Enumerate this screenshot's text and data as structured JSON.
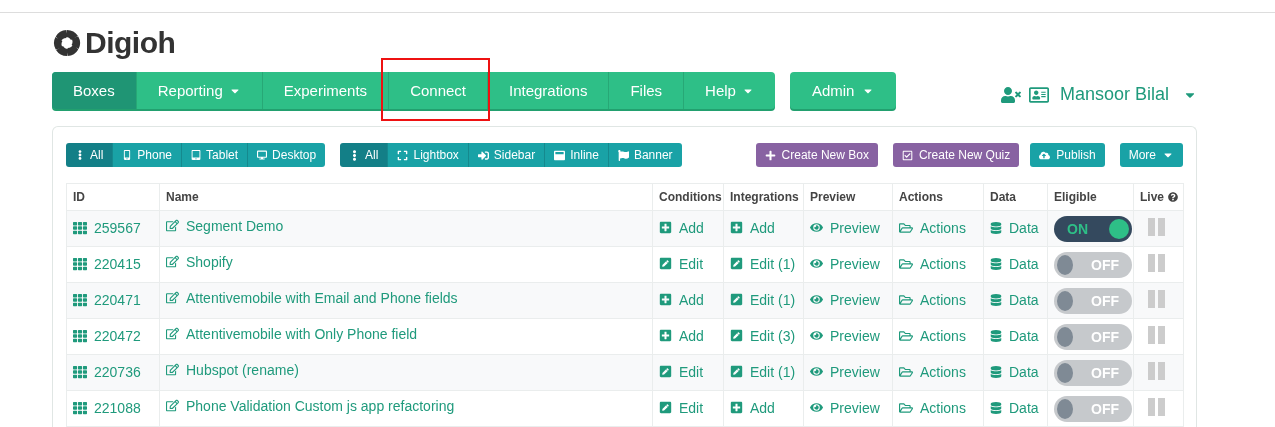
{
  "brand": {
    "name": "Digioh"
  },
  "nav": [
    {
      "label": "Boxes",
      "selected": true,
      "dropdown": false,
      "highlighted": false
    },
    {
      "label": "Reporting",
      "selected": false,
      "dropdown": true,
      "highlighted": false
    },
    {
      "label": "Experiments",
      "selected": false,
      "dropdown": false,
      "highlighted": false
    },
    {
      "label": "Connect",
      "selected": false,
      "dropdown": false,
      "highlighted": true
    },
    {
      "label": "Integrations",
      "selected": false,
      "dropdown": false,
      "highlighted": false
    },
    {
      "label": "Files",
      "selected": false,
      "dropdown": false,
      "highlighted": false
    },
    {
      "label": "Help",
      "selected": false,
      "dropdown": true,
      "highlighted": false
    }
  ],
  "admin_menu": {
    "label": "Admin"
  },
  "user": {
    "name": "Mansoor Bilal"
  },
  "device_filters": [
    {
      "label": "All",
      "selected": true
    },
    {
      "label": "Phone",
      "selected": false
    },
    {
      "label": "Tablet",
      "selected": false
    },
    {
      "label": "Desktop",
      "selected": false
    }
  ],
  "type_filters": [
    {
      "label": "All",
      "selected": true
    },
    {
      "label": "Lightbox",
      "selected": false
    },
    {
      "label": "Sidebar",
      "selected": false
    },
    {
      "label": "Inline",
      "selected": false
    },
    {
      "label": "Banner",
      "selected": false
    }
  ],
  "actions": [
    {
      "label": "Create New Box",
      "kind": "create"
    },
    {
      "label": "Create New Quiz",
      "kind": "quiz"
    },
    {
      "label": "Publish",
      "kind": "publish"
    },
    {
      "label": "More",
      "kind": "more"
    }
  ],
  "table": {
    "columns": [
      "ID",
      "Name",
      "Conditions",
      "Integrations",
      "Preview",
      "Actions",
      "Data",
      "Eligible",
      "Live"
    ],
    "rows": [
      {
        "id": "259567",
        "name": "Segment Demo",
        "conditions": {
          "label": "Add",
          "kind": "add"
        },
        "integrations": {
          "label": "Add",
          "kind": "add"
        },
        "preview": "Preview",
        "actions": "Actions",
        "data": "Data",
        "eligible": {
          "label": "ON",
          "on": true
        }
      },
      {
        "id": "220415",
        "name": "Shopify",
        "conditions": {
          "label": "Edit",
          "kind": "edit"
        },
        "integrations": {
          "label": "Edit (1)",
          "kind": "edit"
        },
        "preview": "Preview",
        "actions": "Actions",
        "data": "Data",
        "eligible": {
          "label": "OFF",
          "on": false
        }
      },
      {
        "id": "220471",
        "name": "Attentivemobile with Email and Phone fields",
        "conditions": {
          "label": "Add",
          "kind": "add"
        },
        "integrations": {
          "label": "Edit (1)",
          "kind": "edit"
        },
        "preview": "Preview",
        "actions": "Actions",
        "data": "Data",
        "eligible": {
          "label": "OFF",
          "on": false
        }
      },
      {
        "id": "220472",
        "name": "Attentivemobile with Only Phone field",
        "conditions": {
          "label": "Add",
          "kind": "add"
        },
        "integrations": {
          "label": "Edit (3)",
          "kind": "edit"
        },
        "preview": "Preview",
        "actions": "Actions",
        "data": "Data",
        "eligible": {
          "label": "OFF",
          "on": false
        }
      },
      {
        "id": "220736",
        "name": "Hubspot (rename)",
        "conditions": {
          "label": "Edit",
          "kind": "edit"
        },
        "integrations": {
          "label": "Edit (1)",
          "kind": "edit"
        },
        "preview": "Preview",
        "actions": "Actions",
        "data": "Data",
        "eligible": {
          "label": "OFF",
          "on": false
        }
      },
      {
        "id": "221088",
        "name": "Phone Validation Custom js app refactoring",
        "conditions": {
          "label": "Edit",
          "kind": "edit"
        },
        "integrations": {
          "label": "Add",
          "kind": "add"
        },
        "preview": "Preview",
        "actions": "Actions",
        "data": "Data",
        "eligible": {
          "label": "OFF",
          "on": false
        }
      }
    ]
  }
}
